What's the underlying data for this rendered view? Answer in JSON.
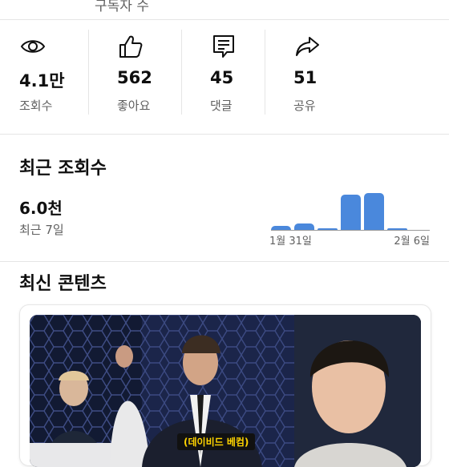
{
  "header": {
    "subscribers_label": "구독자 수"
  },
  "stats": [
    {
      "icon": "eye-icon",
      "value": "4.1만",
      "label": "조회수"
    },
    {
      "icon": "thumbs-up-icon",
      "value": "562",
      "label": "좋아요"
    },
    {
      "icon": "comment-icon",
      "value": "45",
      "label": "댓글"
    },
    {
      "icon": "share-icon",
      "value": "51",
      "label": "공유"
    }
  ],
  "recent_views": {
    "title": "최근 조회수",
    "value": "6.0천",
    "period": "최근 7일"
  },
  "chart_data": {
    "type": "bar",
    "categories": [
      "1월 31일",
      "",
      "",
      "",
      "",
      "2월 6일"
    ],
    "values": [
      5,
      8,
      1,
      43,
      45,
      2
    ],
    "x_tick_labels": [
      "1월 31일",
      "2월 6일"
    ],
    "color": "#4a88dc",
    "grid": false
  },
  "latest_content": {
    "title": "최신 콘텐츠",
    "thumbnail_caption": "(데이비드 베컴)"
  }
}
